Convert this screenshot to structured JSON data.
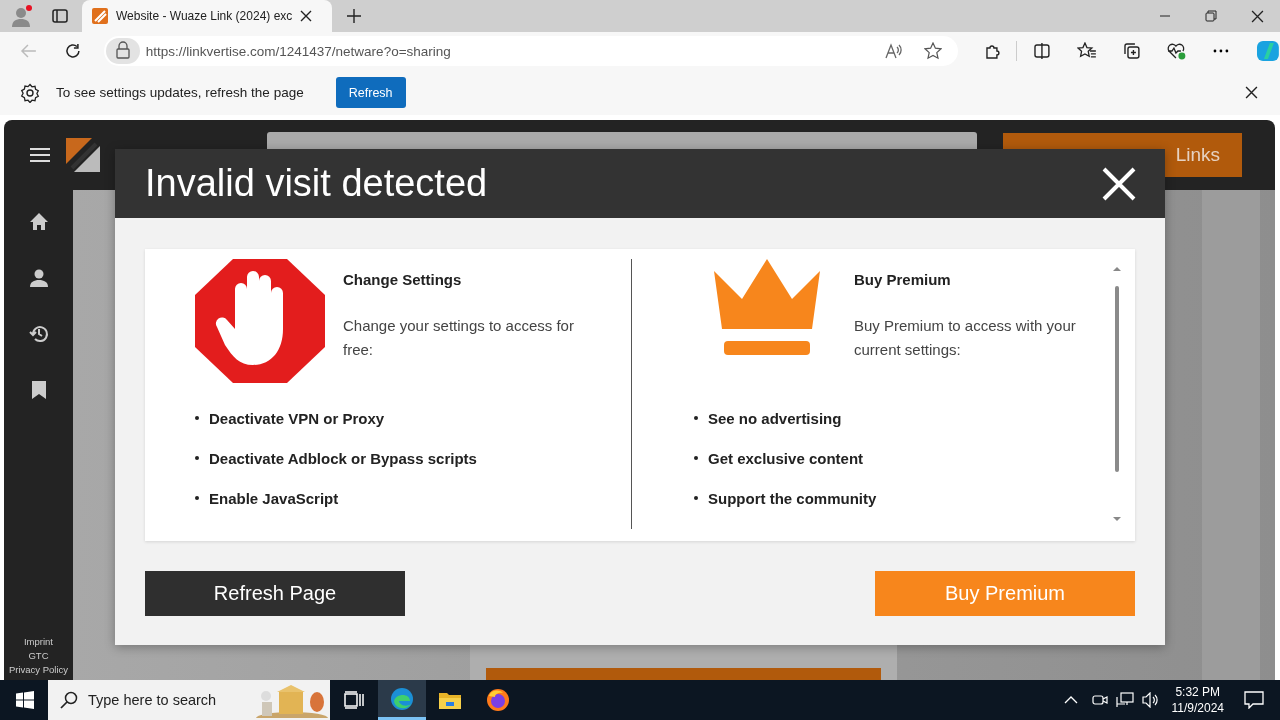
{
  "browser": {
    "tabs": [
      {
        "title": "Website - Wuaze Link (2024) exc",
        "selected": true
      }
    ],
    "url": "https://linkvertise.com/1241437/netware?o=sharing",
    "infobar": {
      "message": "To see settings updates, refresh the page",
      "button": "Refresh"
    }
  },
  "website": {
    "header_button": "Links",
    "footer_links": [
      "Imprint",
      "GTC",
      "Privacy Policy"
    ]
  },
  "modal": {
    "title": "Invalid visit detected",
    "options": [
      {
        "kind": "stop",
        "heading": "Change Settings",
        "description": "Change your settings to access for free:",
        "bullets": [
          "Deactivate VPN or Proxy",
          "Deactivate Adblock or Bypass scripts",
          "Enable JavaScript"
        ]
      },
      {
        "kind": "crown",
        "heading": "Buy Premium",
        "description": "Buy Premium to access with your current settings:",
        "bullets": [
          "See no advertising",
          "Get exclusive content",
          "Support the community"
        ]
      }
    ],
    "buttons": [
      {
        "label": "Refresh Page",
        "kind": "dark"
      },
      {
        "label": "Buy Premium",
        "kind": "orange"
      }
    ]
  },
  "taskbar": {
    "search_placeholder": "Type here to search",
    "apps": [
      {
        "kind": "taskview",
        "selected": false
      },
      {
        "kind": "edge",
        "selected": true
      },
      {
        "kind": "folder",
        "selected": false
      },
      {
        "kind": "firefox",
        "selected": false
      }
    ],
    "time": "5:32 PM",
    "date": "11/9/2024"
  }
}
